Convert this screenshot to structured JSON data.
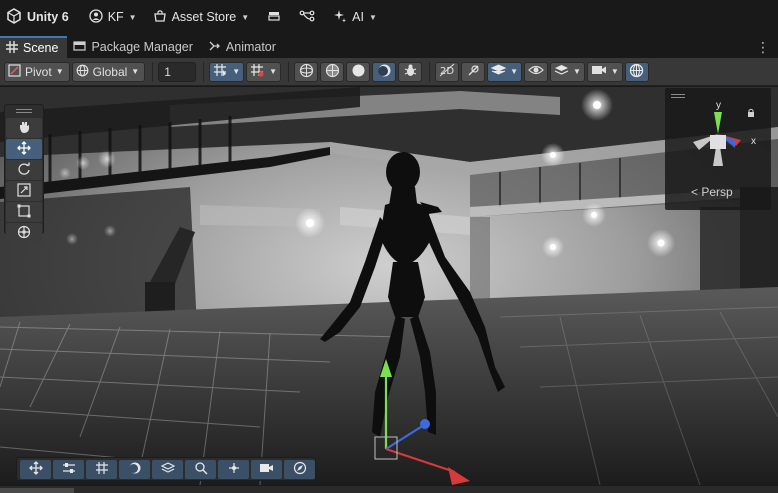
{
  "topbar": {
    "app_label": "Unity 6",
    "account_label": "KF",
    "asset_store_label": "Asset Store",
    "ai_label": "AI"
  },
  "tabs": [
    {
      "label": "Scene",
      "icon": "grid-icon",
      "active": true
    },
    {
      "label": "Package Manager",
      "icon": "package-icon",
      "active": false
    },
    {
      "label": "Animator",
      "icon": "animator-icon",
      "active": false
    }
  ],
  "toolbar": {
    "pivot_label": "Pivot",
    "global_label": "Global",
    "grid_snap_value": "1"
  },
  "viewport": {
    "camera_mode": "Persp",
    "axis_y": "y",
    "axis_x": "x"
  },
  "colors": {
    "accent": "#3a79bb",
    "selected_tool": "#46607c",
    "axis_x": "#d63a3a",
    "axis_y": "#7be04f",
    "axis_z": "#3a6be0"
  }
}
